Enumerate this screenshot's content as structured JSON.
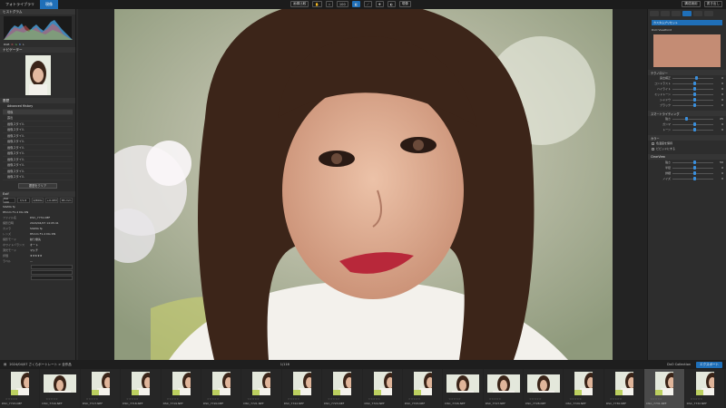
{
  "topbar": {
    "tabs": [
      "フォトライブラリ",
      "現像"
    ],
    "center_buttons": [
      "画像比較",
      "100",
      "現像"
    ],
    "right_buttons": [
      "構成適用",
      "書き出し"
    ]
  },
  "left": {
    "histogram_title": "ヒストグラム",
    "histogram_vals": [
      "RGB",
      "R",
      "G",
      "B",
      "L"
    ],
    "nav_title": "ナビゲーター",
    "history_title": "履歴",
    "history_head": "Advanced History",
    "history_rows": [
      "現像",
      "露出",
      "画像スタイル",
      "画像スタイル",
      "画像スタイル",
      "画像スタイル",
      "画像スタイル",
      "画像スタイル",
      "画像スタイル",
      "画像スタイル",
      "画像スタイル",
      "画像スタイル"
    ],
    "history_button": "履歴をクリア",
    "exif_title": "Exif",
    "exif_cells": [
      "ISO 100",
      "f/1.8",
      "1/800s",
      "+0.0EV",
      "85 mm"
    ],
    "exif_line1": "SIGMA fp",
    "exif_line2": "85mm F1.4 DG DN",
    "meta": [
      {
        "k": "ファイル名",
        "v": "DSC_7731.NEF"
      },
      {
        "k": "撮影日時",
        "v": "2024/04/07 14:05:41"
      },
      {
        "k": "カメラ",
        "v": "SIGMA fp"
      },
      {
        "k": "レンズ",
        "v": "85mm F1.4 DG DN"
      },
      {
        "k": "撮影モード",
        "v": "絞り優先"
      },
      {
        "k": "ホワイトバランス",
        "v": "オート"
      },
      {
        "k": "測光モード",
        "v": "マルチ"
      },
      {
        "k": "評価",
        "v": "★★★★★"
      },
      {
        "k": "ラベル",
        "v": "—"
      }
    ]
  },
  "right": {
    "preset_label": "DxO ViewPoint",
    "dropdown": "カスタムプリセット",
    "section1": "テクノロジー",
    "sliders1": [
      {
        "label": "露出補正",
        "val": "0"
      },
      {
        "label": "コントラスト",
        "val": "0"
      },
      {
        "label": "ハイライト",
        "val": "0"
      },
      {
        "label": "ミッドトーン",
        "val": "0"
      },
      {
        "label": "シャドウ",
        "val": "0"
      },
      {
        "label": "ブラック",
        "val": "0"
      }
    ],
    "section2": "スマートライティング",
    "sliders2": [
      {
        "label": "強さ",
        "val": "25"
      },
      {
        "label": "ガンマ",
        "val": "0"
      },
      {
        "label": "トーン",
        "val": "0"
      }
    ],
    "section3": "カラー",
    "checks": [
      "色温度を保持",
      "ビビッドにする"
    ],
    "section4": "ClearView",
    "sliders3": [
      {
        "label": "強さ",
        "val": "50"
      },
      {
        "label": "半径",
        "val": "0"
      },
      {
        "label": "詳細",
        "val": "0"
      },
      {
        "label": "ノイズ",
        "val": "0"
      }
    ]
  },
  "stripbar": {
    "path": "2024/04/07 さくらポートレート > 全作品",
    "count": "1/116",
    "collection": "DxO Collection",
    "export": "エクスポート"
  },
  "filmstrip": [
    {
      "name": "DSC_7715.NEF",
      "wide": false
    },
    {
      "name": "DSC_7716.NEF",
      "wide": true
    },
    {
      "name": "DSC_7717.NEF",
      "wide": false
    },
    {
      "name": "DSC_7718.NEF",
      "wide": false
    },
    {
      "name": "DSC_7719.NEF",
      "wide": false
    },
    {
      "name": "DSC_7720.NEF",
      "wide": false
    },
    {
      "name": "DSC_7721.NEF",
      "wide": false
    },
    {
      "name": "DSC_7722.NEF",
      "wide": false
    },
    {
      "name": "DSC_7723.NEF",
      "wide": false
    },
    {
      "name": "DSC_7724.NEF",
      "wide": false
    },
    {
      "name": "DSC_7725.NEF",
      "wide": false
    },
    {
      "name": "DSC_7726.NEF",
      "wide": true
    },
    {
      "name": "DSC_7727.NEF",
      "wide": true
    },
    {
      "name": "DSC_7728.NEF",
      "wide": true
    },
    {
      "name": "DSC_7729.NEF",
      "wide": false
    },
    {
      "name": "DSC_7730.NEF",
      "wide": false
    },
    {
      "name": "DSC_7731.NEF",
      "wide": false
    },
    {
      "name": "DSC_7732.NEF",
      "wide": false
    }
  ]
}
